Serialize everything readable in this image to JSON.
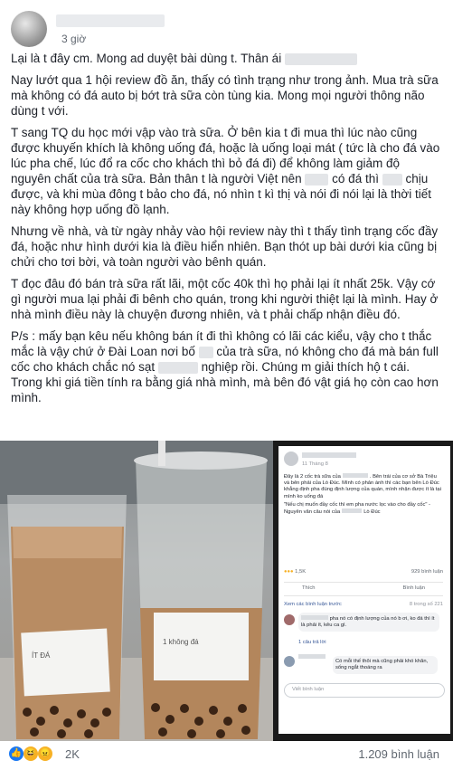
{
  "post": {
    "time": "3 giờ",
    "paragraphs": {
      "p1": "Lại là t đây cm. Mong ad duyệt bài dùng t. Thân ái",
      "p2": "Nay lướt qua 1 hội review đồ ăn, thấy có tình trạng như trong ảnh. Mua trà sữa mà không có đá auto bị bớt trà sữa còn tùng kia. Mong mọi người thông não dùng t với.",
      "p3a": "T sang TQ du học mới vập vào trà sữa. Ở bên kia t đi mua thì lúc nào cũng được khuyến khích là không uống đá, hoặc là uống loại mát ( tức là cho đá vào lúc pha chế, lúc đổ ra cốc cho khách thì bỏ đá đi) để không làm giảm độ nguyên chất của trà sữa. Bản thân t là người Việt nên",
      "p3b": "có đá thì",
      "p3c": "chịu được, và khi mùa đông t bảo cho đá, nó nhìn t kì thị và nói đi nói lại là thời tiết này không hợp uống đồ lạnh.",
      "p4": "Nhưng về nhà, và từ ngày nhảy vào hội review này thì t thấy tình trạng cốc đầy đá, hoặc như hình dưới kia là điều hiển nhiên. Bạn thót up bài dưới kia cũng bị chửi cho tơi bời, và toàn người vào bênh quán.",
      "p5": "T đọc đâu đó bán trà sữa rất lãi, một cốc 40k thì họ phải lại ít nhất 25k. Vậy cớ gì người mua lại phải đi bênh cho quán, trong khi người thiệt lại là mình. Hay ở nhà mình điều này là chuyện đương nhiên, và t phải chấp nhận điều đó.",
      "p6a": "P/s : mấy bạn kêu nếu không bán ít đi thì không có lãi các kiểu, vậy cho t thắc mắc là vậy chứ ở Đài Loan nơi bố",
      "p6b": "của trà sữa, nó không cho đá mà bán full cốc cho khách chắc nó sạt",
      "p6c": "nghiệp rồi. Chúng m giải thích hộ t cái. Trong khi giá tiền tính ra bằng giá nhà mình, mà bên đó vật giá họ còn cao hơn mình."
    }
  },
  "screenshot": {
    "date": "11 Tháng 8",
    "text1": "Đây là 2 cốc trà sữa của",
    "text2": ". Bên trái của cơ sở Bà Triệu và bên phải của Lò Đúc. Mình có phản ánh thì các bạn bên Lò Đúc khẳng định pha đúng định lượng của quán, mình nhận được ít là tại mình ko uống đá",
    "quote": "\"Nếu chị muốn đầy cốc thì em pha nước lọc vào cho đầy cốc\" - Nguyên văn câu nói của",
    "quote_end": "Lò Đúc",
    "reactions": "1,5K",
    "shares": "929 bình luận",
    "like": "Thích",
    "comment": "Bình luận",
    "prev_comments": "Xem các bình luận trước",
    "comment_count": "8 trong số 221",
    "c1": "pha nó có định lượng của nó b ơi, ko đá thì ít là phải ít, kêu ca gì.",
    "reply": "1 câu trả lời",
    "c2": "Có mỗi thế thôi mà cũng phải khó khăn, sống ngắt thoáng ra",
    "write": "Viết bình luận"
  },
  "labels": {
    "cup_left": "ÍT ĐÁ",
    "cup_right": "1 không đá"
  },
  "footer": {
    "reaction_count": "2K",
    "comment_count": "1.209 bình luận"
  }
}
